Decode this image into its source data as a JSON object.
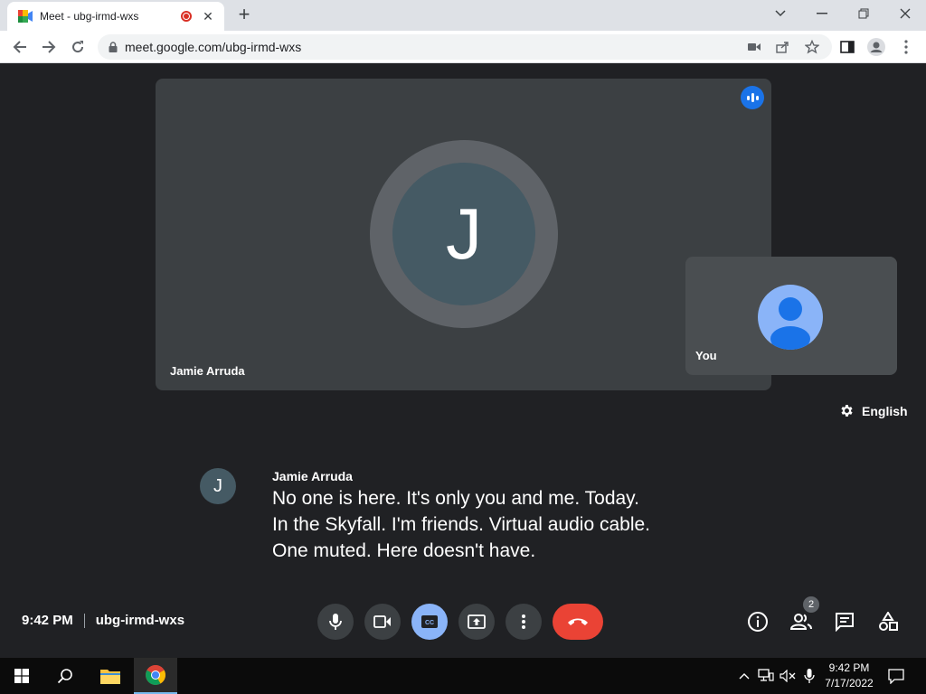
{
  "browser": {
    "tab_title": "Meet - ubg-irmd-wxs",
    "url": "meet.google.com/ubg-irmd-wxs"
  },
  "meeting": {
    "main_participant": {
      "initial": "J",
      "name": "Jamie Arruda"
    },
    "self_tile": {
      "name": "You"
    },
    "caption_language": "English",
    "caption": {
      "initial": "J",
      "speaker": "Jamie Arruda",
      "lines": [
        "No one is here. It's only you and me. Today.",
        "In the Skyfall. I'm friends. Virtual audio cable.",
        "One muted. Here doesn't have."
      ]
    },
    "time": "9:42 PM",
    "meeting_code": "ubg-irmd-wxs",
    "participant_count": "2"
  },
  "taskbar": {
    "time": "9:42 PM",
    "date": "7/17/2022"
  },
  "colors": {
    "background": "#202124",
    "tile": "#3c4043",
    "accent_blue": "#1a73e8",
    "cc_active": "#8ab4f8",
    "end_call": "#ea4335"
  }
}
